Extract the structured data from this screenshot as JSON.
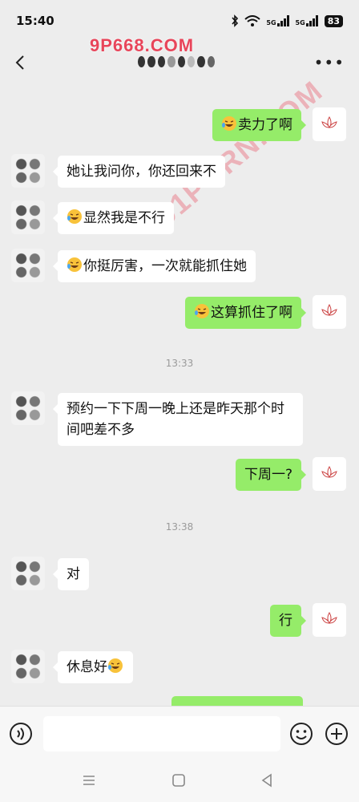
{
  "status": {
    "time": "15:40",
    "battery": "83",
    "signal_1": "5G",
    "signal_2": "5G"
  },
  "header": {
    "watermark": "9P668.COM"
  },
  "overlay_watermark": "91PORN.COM",
  "timestamps": [
    "13:33",
    "13:38"
  ],
  "messages": [
    {
      "side": "out",
      "text": "卖力了啊",
      "emoji": true
    },
    {
      "side": "in",
      "text": "她让我问你，你还回来不",
      "emoji": false
    },
    {
      "side": "in",
      "text": "显然我是不行",
      "emoji": true
    },
    {
      "side": "in",
      "text": "你挺厉害，一次就能抓住她",
      "emoji": true
    },
    {
      "side": "out",
      "text": "这算抓住了啊",
      "emoji": true
    },
    {
      "side": "in",
      "text": "预约一下下周一晚上还是昨天那个时间吧差不多",
      "emoji": false
    },
    {
      "side": "out",
      "text": "下周一?",
      "emoji": false
    },
    {
      "side": "in",
      "text": "对",
      "emoji": false
    },
    {
      "side": "out",
      "text": "行",
      "emoji": false
    },
    {
      "side": "in",
      "text": "休息好",
      "emoji": true
    }
  ],
  "icons": {
    "back": "back-arrow-icon",
    "more": "more-icon",
    "voice": "voice-icon",
    "emoji": "emoji-icon",
    "plus": "plus-icon"
  },
  "colors": {
    "background": "#ededed",
    "outgoing_bubble": "#95ec69",
    "incoming_bubble": "#ffffff",
    "watermark": "#e8455a"
  }
}
